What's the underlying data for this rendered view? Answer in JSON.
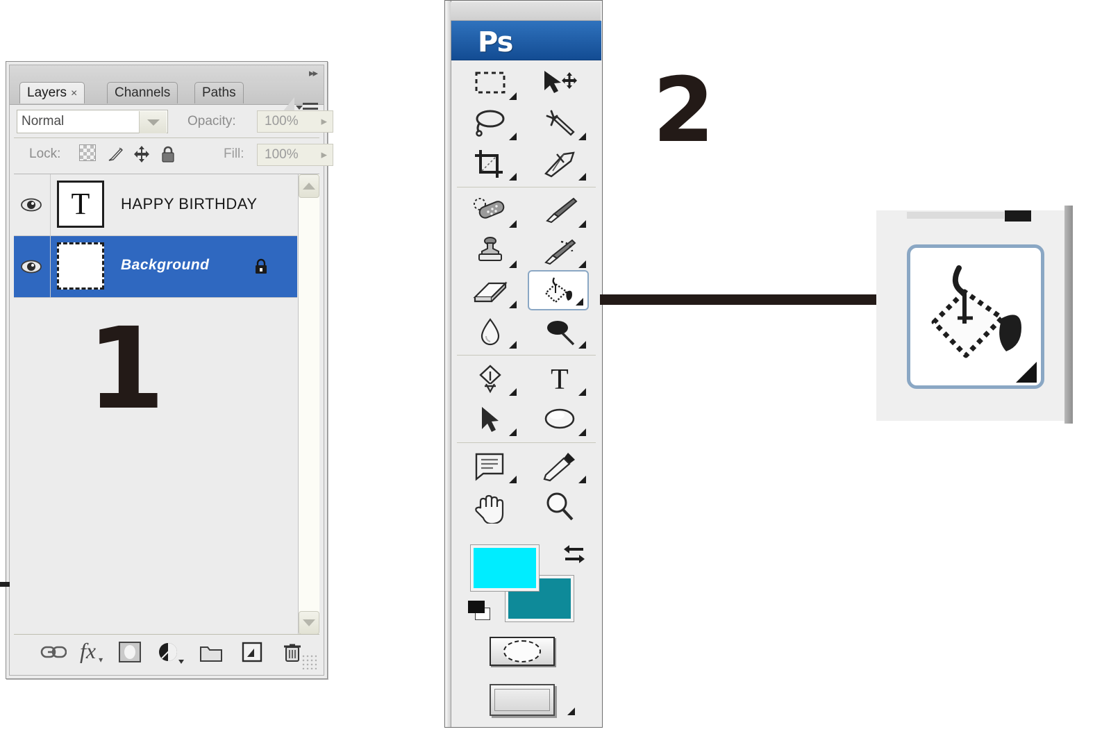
{
  "app": {
    "brand_label": "Ps"
  },
  "annotations": [
    {
      "name": "annotation-1",
      "label": "1"
    },
    {
      "name": "annotation-2",
      "label": "2"
    }
  ],
  "layers_panel": {
    "collapse_icon": "double-chevron-right-icon",
    "tabs": [
      {
        "label": "Layers",
        "close": "×",
        "active": true
      },
      {
        "label": "Channels",
        "active": false
      },
      {
        "label": "Paths",
        "active": false
      }
    ],
    "blend_mode": {
      "value": "Normal",
      "dropdown_icon": "chevron-down-icon"
    },
    "opacity": {
      "label": "Opacity:",
      "value": "100%",
      "stepper_icon": "▸"
    },
    "lock": {
      "label": "Lock:",
      "icons": [
        "lock-transparency-icon",
        "lock-image-pixels-icon",
        "lock-position-icon",
        "lock-all-icon"
      ]
    },
    "fill": {
      "label": "Fill:",
      "value": "100%",
      "stepper_icon": "▸"
    },
    "layers": [
      {
        "name": "HAPPY BIRTHDAY",
        "thumb_glyph": "T",
        "visible": true,
        "selected": false,
        "locked": false,
        "type": "text"
      },
      {
        "name": "Background",
        "thumb_glyph": "",
        "visible": true,
        "selected": true,
        "locked": true,
        "type": "raster"
      }
    ],
    "scrollbar": {
      "up_icon": "chevron-up-icon",
      "down_icon": "chevron-down-icon"
    },
    "footer_buttons": [
      {
        "name": "link-layers-button",
        "icon": "link-icon"
      },
      {
        "name": "layer-style-button",
        "icon": "fx-icon",
        "glyph": "fx"
      },
      {
        "name": "layer-mask-button",
        "icon": "mask-icon"
      },
      {
        "name": "adjustment-layer-button",
        "icon": "half-circle-icon"
      },
      {
        "name": "new-group-button",
        "icon": "folder-icon"
      },
      {
        "name": "new-layer-button",
        "icon": "new-layer-icon"
      },
      {
        "name": "delete-layer-button",
        "icon": "trash-icon"
      }
    ],
    "panel_menu_icon": "panel-menu-icon",
    "resize-grip": "resize-grip-icon"
  },
  "toolbox": {
    "tools": [
      {
        "row": 0,
        "col": 0,
        "name": "rectangular-marquee-tool",
        "icon": "marquee-icon",
        "selected": false,
        "has_flyout": true
      },
      {
        "row": 0,
        "col": 1,
        "name": "move-tool",
        "icon": "move-icon",
        "selected": false,
        "has_flyout": false
      },
      {
        "row": 1,
        "col": 0,
        "name": "lasso-tool",
        "icon": "lasso-icon",
        "selected": false,
        "has_flyout": true
      },
      {
        "row": 1,
        "col": 1,
        "name": "magic-wand-tool",
        "icon": "magic-wand-icon",
        "selected": false,
        "has_flyout": true
      },
      {
        "row": 2,
        "col": 0,
        "name": "crop-tool",
        "icon": "crop-icon",
        "selected": false,
        "has_flyout": true
      },
      {
        "row": 2,
        "col": 1,
        "name": "slice-tool",
        "icon": "slice-knife-icon",
        "selected": false,
        "has_flyout": true
      },
      {
        "row": 3,
        "col": 0,
        "name": "spot-healing-brush-tool",
        "icon": "bandage-icon",
        "selected": false,
        "has_flyout": true
      },
      {
        "row": 3,
        "col": 1,
        "name": "brush-tool",
        "icon": "paintbrush-icon",
        "selected": false,
        "has_flyout": true
      },
      {
        "row": 4,
        "col": 0,
        "name": "clone-stamp-tool",
        "icon": "stamp-icon",
        "selected": false,
        "has_flyout": true
      },
      {
        "row": 4,
        "col": 1,
        "name": "history-brush-tool",
        "icon": "history-brush-icon",
        "selected": false,
        "has_flyout": true
      },
      {
        "row": 5,
        "col": 0,
        "name": "eraser-tool",
        "icon": "eraser-icon",
        "selected": false,
        "has_flyout": true
      },
      {
        "row": 5,
        "col": 1,
        "name": "paint-bucket-tool",
        "icon": "paint-bucket-icon",
        "selected": true,
        "has_flyout": true
      },
      {
        "row": 6,
        "col": 0,
        "name": "blur-tool",
        "icon": "waterdrop-icon",
        "selected": false,
        "has_flyout": true
      },
      {
        "row": 6,
        "col": 1,
        "name": "dodge-tool",
        "icon": "dodge-icon",
        "selected": false,
        "has_flyout": true
      },
      {
        "row": 7,
        "col": 0,
        "name": "pen-tool",
        "icon": "pen-icon",
        "selected": false,
        "has_flyout": true
      },
      {
        "row": 7,
        "col": 1,
        "name": "type-tool",
        "icon": "type-T-icon",
        "selected": false,
        "has_flyout": true
      },
      {
        "row": 8,
        "col": 0,
        "name": "path-selection-tool",
        "icon": "arrow-pointer-icon",
        "selected": false,
        "has_flyout": true
      },
      {
        "row": 8,
        "col": 1,
        "name": "ellipse-shape-tool",
        "icon": "ellipse-icon",
        "selected": false,
        "has_flyout": true
      },
      {
        "row": 9,
        "col": 0,
        "name": "notes-tool",
        "icon": "note-icon",
        "selected": false,
        "has_flyout": true
      },
      {
        "row": 9,
        "col": 1,
        "name": "eyedropper-tool",
        "icon": "eyedropper-icon",
        "selected": false,
        "has_flyout": true
      },
      {
        "row": 10,
        "col": 0,
        "name": "hand-tool",
        "icon": "hand-icon",
        "selected": false,
        "has_flyout": false
      },
      {
        "row": 10,
        "col": 1,
        "name": "zoom-tool",
        "icon": "magnifier-icon",
        "selected": false,
        "has_flyout": false
      }
    ],
    "colors": {
      "foreground_hex": "#00EDFF",
      "background_hex": "#0E8A99",
      "swap_icon": "swap-colors-icon",
      "default_icon": "default-colors-icon"
    },
    "quick_mask_button": {
      "name": "quick-mask-mode-button",
      "icon": "quick-mask-icon"
    },
    "screen_mode_button": {
      "name": "screen-mode-button",
      "icon": "screen-mode-icon",
      "has_flyout": true
    }
  },
  "callout": {
    "name": "paint-bucket-zoom-callout",
    "icon": "paint-bucket-icon",
    "connector": "callout-connector-line",
    "accent_hex": "#8AA7C4",
    "line_hex": "#231A17"
  }
}
